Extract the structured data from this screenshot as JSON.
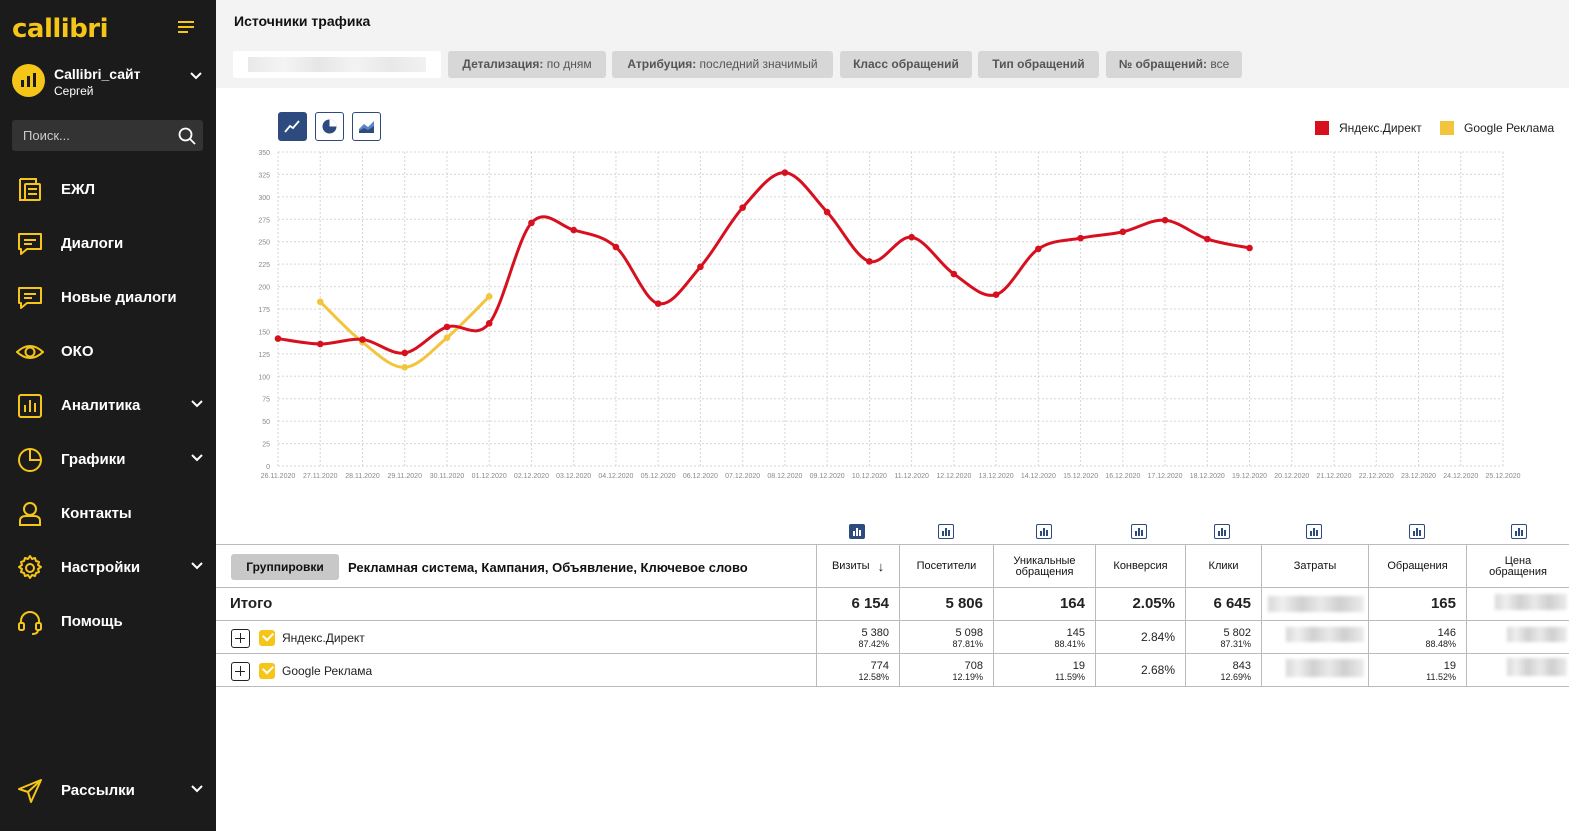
{
  "app": {
    "logo": "callibri"
  },
  "account": {
    "name": "Callibri_сайт",
    "user": "Сергей"
  },
  "search": {
    "placeholder": "Поиск..."
  },
  "sidebar": {
    "items": [
      {
        "label": "ЕЖЛ",
        "icon": "journal-icon",
        "chevron": false
      },
      {
        "label": "Диалоги",
        "icon": "chat-icon",
        "chevron": false
      },
      {
        "label": "Новые диалоги",
        "icon": "new-chat-icon",
        "chevron": false
      },
      {
        "label": "ОКО",
        "icon": "eye-icon",
        "chevron": false
      },
      {
        "label": "Аналитика",
        "icon": "bar-chart-icon",
        "chevron": true
      },
      {
        "label": "Графики",
        "icon": "pie-chart-icon",
        "chevron": true
      },
      {
        "label": "Контакты",
        "icon": "contact-icon",
        "chevron": false
      },
      {
        "label": "Настройки",
        "icon": "gear-icon",
        "chevron": true
      },
      {
        "label": "Помощь",
        "icon": "headset-icon",
        "chevron": false
      },
      {
        "label": "Рассылки",
        "icon": "paper-plane-icon",
        "chevron": true
      }
    ]
  },
  "page": {
    "title": "Источники трафика"
  },
  "filters": [
    {
      "key": "Детализация:",
      "value": "по дням"
    },
    {
      "key": "Атрибуция:",
      "value": "последний значимый"
    },
    {
      "key": "Класс обращений",
      "value": ""
    },
    {
      "key": "Тип обращений",
      "value": ""
    },
    {
      "key": "№ обращений:",
      "value": "все"
    }
  ],
  "colors": {
    "accent": "#f5c518",
    "sidebar_bg": "#1b1b1b",
    "yandex": "#d7101f",
    "google": "#f2c53d",
    "chart_button": "#2d4b7f"
  },
  "chart_data": {
    "type": "line",
    "x": [
      "26.11.2020",
      "27.11.2020",
      "28.11.2020",
      "29.11.2020",
      "30.11.2020",
      "01.12.2020",
      "02.12.2020",
      "03.12.2020",
      "04.12.2020",
      "05.12.2020",
      "06.12.2020",
      "07.12.2020",
      "08.12.2020",
      "09.12.2020",
      "10.12.2020",
      "11.12.2020",
      "12.12.2020",
      "13.12.2020",
      "14.12.2020",
      "15.12.2020",
      "16.12.2020",
      "17.12.2020",
      "18.12.2020",
      "19.12.2020",
      "20.12.2020",
      "21.12.2020",
      "22.12.2020",
      "23.12.2020",
      "24.12.2020",
      "25.12.2020"
    ],
    "yticks": [
      0,
      25,
      50,
      75,
      100,
      125,
      150,
      175,
      200,
      225,
      250,
      275,
      300,
      325,
      350
    ],
    "ylim": [
      0,
      350
    ],
    "series": [
      {
        "name": "Яндекс.Директ",
        "color": "#d7101f",
        "values": [
          142,
          136,
          141,
          126,
          155,
          159,
          271,
          263,
          244,
          181,
          222,
          288,
          327,
          283,
          228,
          255,
          214,
          191,
          242,
          254,
          261,
          274,
          253,
          243,
          null,
          null,
          null,
          null,
          null,
          null
        ]
      },
      {
        "name": "Google Реклама",
        "color": "#f2c53d",
        "values": [
          null,
          183,
          138,
          110,
          143,
          189,
          null,
          null,
          null,
          null,
          null,
          null,
          null,
          null,
          null,
          null,
          null,
          null,
          null,
          null,
          null,
          null,
          null,
          null,
          null,
          null,
          null,
          null,
          null,
          null
        ]
      }
    ],
    "legend": "top-right",
    "grid": true
  },
  "table": {
    "grouping_button": "Группировки",
    "grouping_text": "Рекламная система, Кампания, Объявление, Ключевое слово",
    "columns": [
      {
        "label": "Визиты",
        "sort": "↓"
      },
      {
        "label": "Посетители"
      },
      {
        "label": "Уникальные обращения"
      },
      {
        "label": "Конверсия"
      },
      {
        "label": "Клики"
      },
      {
        "label": "Затраты"
      },
      {
        "label": "Обращения"
      },
      {
        "label": "Цена обращения"
      }
    ],
    "total": {
      "label": "Итого",
      "visits": "6 154",
      "visitors": "5 806",
      "unique": "164",
      "conversion": "2.05%",
      "clicks": "6 645",
      "requests": "165"
    },
    "rows": [
      {
        "name": "Яндекс.Директ",
        "visits": "5 380",
        "visits_pct": "87.42%",
        "visitors": "5 098",
        "visitors_pct": "87.81%",
        "unique": "145",
        "unique_pct": "88.41%",
        "conversion": "2.84%",
        "clicks": "5 802",
        "clicks_pct": "87.31%",
        "requests": "146",
        "requests_pct": "88.48%"
      },
      {
        "name": "Google Реклама",
        "visits": "774",
        "visits_pct": "12.58%",
        "visitors": "708",
        "visitors_pct": "12.19%",
        "unique": "19",
        "unique_pct": "11.59%",
        "conversion": "2.68%",
        "clicks": "843",
        "clicks_pct": "12.69%",
        "requests": "19",
        "requests_pct": "11.52%"
      }
    ]
  }
}
